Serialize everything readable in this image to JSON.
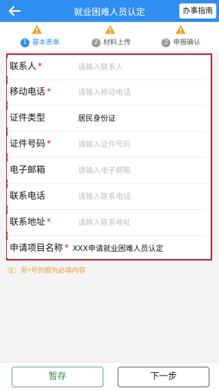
{
  "header": {
    "title": "就业困难人员认定",
    "guide_label": "办事指南",
    "back_icon": "back-arrow-icon"
  },
  "colors": {
    "primary": "#2f8ff0",
    "warning": "#f0a020",
    "frame": "#c8161d",
    "required": "#e02020"
  },
  "steps": [
    {
      "number": "1",
      "label": "基本表单",
      "state": "active"
    },
    {
      "number": "2",
      "label": "材料上传",
      "state": "inactive"
    },
    {
      "number": "3",
      "label": "申报确认",
      "state": "inactive"
    }
  ],
  "form": {
    "required_mark": "*",
    "fields": [
      {
        "label": "联系人",
        "required": true,
        "placeholder": "请输入联系人",
        "value": ""
      },
      {
        "label": "移动电话",
        "required": true,
        "placeholder": "请输入移动电话",
        "value": ""
      },
      {
        "label": "证件类型",
        "required": false,
        "placeholder": "",
        "value": "居民身份证"
      },
      {
        "label": "证件号码",
        "required": true,
        "placeholder": "请输入证件号码",
        "value": ""
      },
      {
        "label": "电子邮箱",
        "required": false,
        "placeholder": "请输入电子邮箱",
        "value": ""
      },
      {
        "label": "联系电话",
        "required": false,
        "placeholder": "请输入联系电话",
        "value": ""
      },
      {
        "label": "联系地址",
        "required": true,
        "placeholder": "请输入联系地址",
        "value": ""
      },
      {
        "label": "申请项目名称",
        "required": true,
        "placeholder": "",
        "value": "XXX申请就业困难人员认定"
      }
    ]
  },
  "note": "注：带*号的都为必填内容",
  "footer": {
    "save_label": "暂存",
    "next_label": "下一步"
  }
}
